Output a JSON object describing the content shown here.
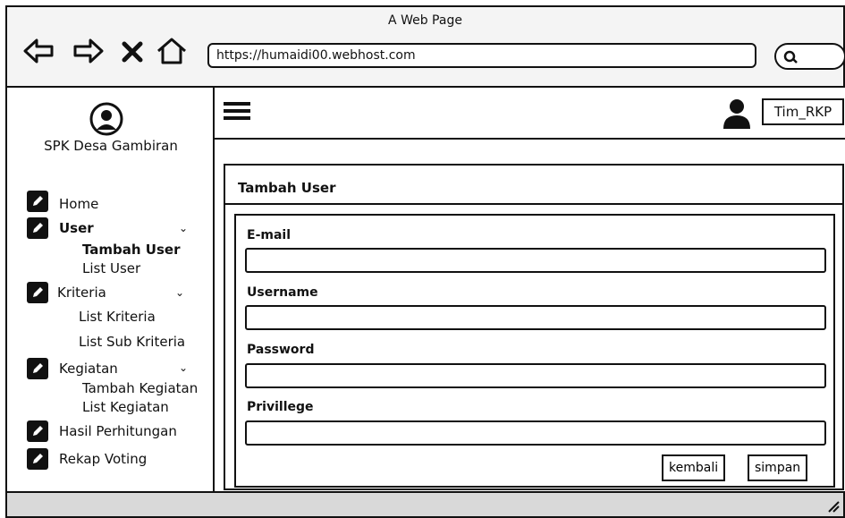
{
  "window": {
    "title": "A Web Page"
  },
  "browser": {
    "url": "https://humaidi00.webhost.com",
    "icons": [
      "back-arrow-icon",
      "forward-arrow-icon",
      "close-icon",
      "home-icon",
      "search-icon"
    ]
  },
  "sidebar": {
    "brand": "SPK Desa Gambiran",
    "items": [
      {
        "label": "Home",
        "active": false
      },
      {
        "label": "User",
        "active": true,
        "children": [
          {
            "label": "Tambah User",
            "active": true
          },
          {
            "label": "List User",
            "active": false
          }
        ]
      },
      {
        "label": "Kriteria",
        "active": false,
        "children": [
          {
            "label": "List Kriteria"
          },
          {
            "label": "List Sub Kriteria"
          }
        ]
      },
      {
        "label": "Kegiatan",
        "active": false,
        "children": [
          {
            "label": "Tambah Kegiatan"
          },
          {
            "label": "List Kegiatan"
          }
        ]
      },
      {
        "label": "Hasil Perhitungan",
        "active": false
      },
      {
        "label": "Rekap Voting",
        "active": false
      }
    ]
  },
  "topbar": {
    "user": "Tim_RKP"
  },
  "card": {
    "title": "Tambah User",
    "fields": [
      {
        "label": "E-mail",
        "value": ""
      },
      {
        "label": "Username",
        "value": ""
      },
      {
        "label": "Password",
        "value": ""
      },
      {
        "label": "Privillege",
        "value": ""
      }
    ],
    "buttons": {
      "back": "kembali",
      "save": "simpan"
    }
  }
}
